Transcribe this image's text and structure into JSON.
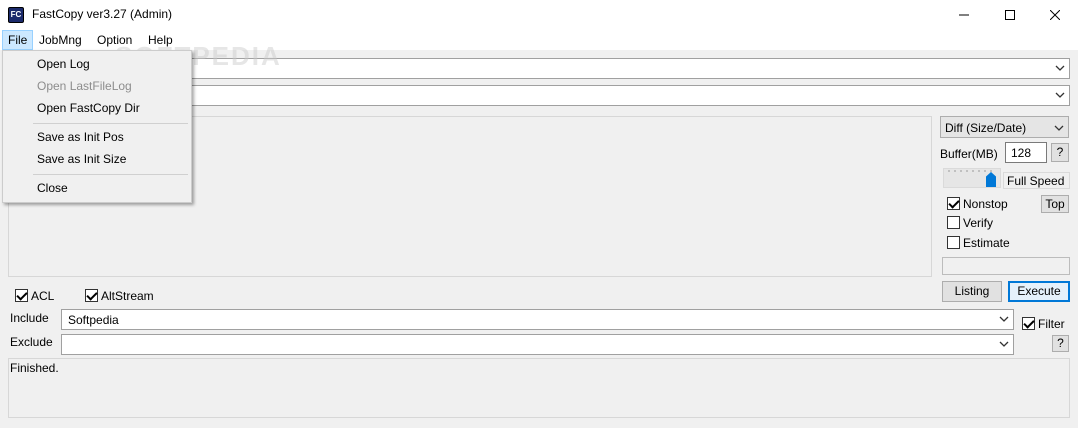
{
  "window": {
    "title": "FastCopy ver3.27 (Admin)",
    "icon_label": "FC",
    "controls": [
      "minimize-icon",
      "maximize-icon",
      "close-icon"
    ]
  },
  "menu": {
    "items": [
      "File",
      "JobMng",
      "Option",
      "Help"
    ],
    "file_dropdown": {
      "group1": [
        "Open Log",
        "Open LastFileLog",
        "Open FastCopy Dir"
      ],
      "group2": [
        "Save as Init Pos",
        "Save as Init Size"
      ],
      "group3": [
        "Close"
      ],
      "disabled": [
        "Open LastFileLog"
      ]
    }
  },
  "watermark": "SOFTPEDIA",
  "right_panel": {
    "mode": "Diff (Size/Date)",
    "buffer_label": "Buffer(MB)",
    "buffer_value": "128",
    "help_label": "?",
    "speed_label": "Full Speed",
    "speed_level": 1.0,
    "nonstop_label": "Nonstop",
    "top_label": "Top",
    "verify_label": "Verify",
    "estimate_label": "Estimate",
    "listing_label": "Listing",
    "execute_label": "Execute"
  },
  "options": {
    "acl_label": "ACL",
    "altstream_label": "AltStream",
    "include_label": "Include",
    "include_value": "Softpedia",
    "exclude_label": "Exclude",
    "exclude_value": "",
    "filter_label": "Filter",
    "filter_help": "?"
  },
  "status": {
    "text": "Finished."
  },
  "checks": {
    "nonstop": true,
    "verify": false,
    "estimate": false,
    "acl": true,
    "altstream": true,
    "filter": true
  }
}
